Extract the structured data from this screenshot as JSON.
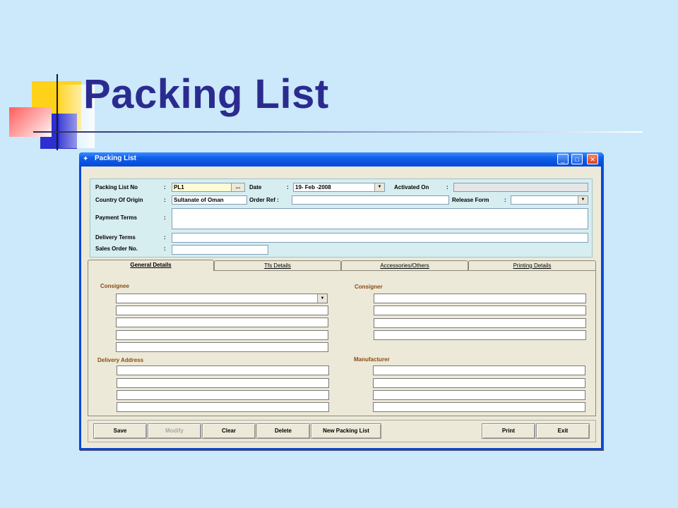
{
  "slide": {
    "title": "Packing List"
  },
  "window": {
    "title": "Packing List",
    "controls": {
      "minimize": "_",
      "maximize": "□",
      "close": "✕"
    }
  },
  "form": {
    "packing_list_no": {
      "label": "Packing List No",
      "value": "PL1",
      "lookup": "..."
    },
    "date": {
      "label": "Date",
      "value": "19- Feb -2008"
    },
    "activated_on": {
      "label": "Activated On",
      "value": ""
    },
    "country_of_origin": {
      "label": "Country Of Origin",
      "value": "Sultanate of Oman"
    },
    "order_ref": {
      "label": "Order Ref :",
      "value": ""
    },
    "release_form": {
      "label": "Release Form",
      "value": ""
    },
    "payment_terms": {
      "label": "Payment Terms",
      "value": ""
    },
    "delivery_terms": {
      "label": "Delivery Terms",
      "value": ""
    },
    "sales_order_no": {
      "label": "Sales Order No.",
      "value": ""
    },
    "colon": ":"
  },
  "tabs": [
    {
      "label": "General Details",
      "active": true
    },
    {
      "label": "Tfs Details",
      "active": false
    },
    {
      "label": "Accessories/Others",
      "active": false
    },
    {
      "label": "Printing Details",
      "active": false
    }
  ],
  "general": {
    "consignee_label": "Consignee",
    "consigner_label": "Consigner",
    "delivery_address_label": "Delivery Address",
    "manufacturer_label": "Manufacturer"
  },
  "buttons": {
    "save": "Save",
    "modify": "Modify",
    "clear": "Clear",
    "delete": "Delete",
    "new_packing_list": "New Packing List",
    "print": "Print",
    "exit": "Exit"
  },
  "colors": {
    "slide_background": "#cce8fb",
    "title_color": "#2b2b8f",
    "section_label_color": "#8a4a12",
    "window_frame": "#0a47d6"
  },
  "icons": {
    "dropdown": "▼"
  }
}
